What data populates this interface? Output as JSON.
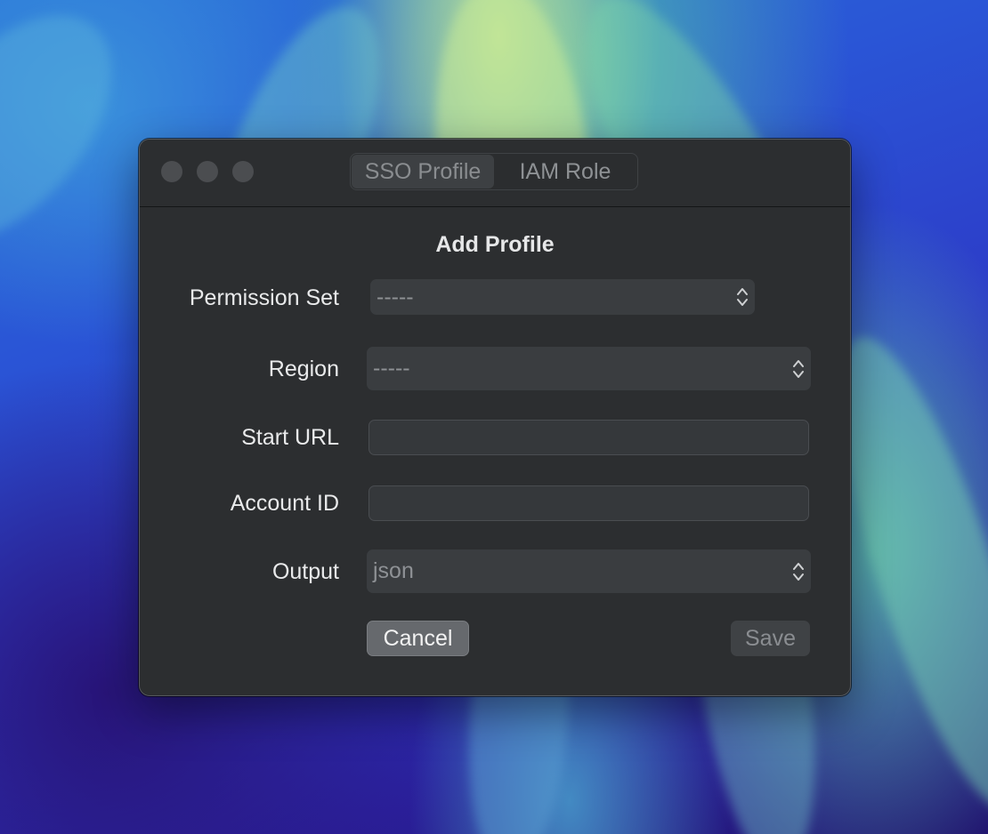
{
  "window": {
    "controls": [
      "close",
      "minimize",
      "zoom"
    ]
  },
  "tabs": [
    {
      "label": "SSO Profile",
      "selected": true
    },
    {
      "label": "IAM Role",
      "selected": false
    }
  ],
  "dialog": {
    "title": "Add Profile"
  },
  "form": {
    "permission_set": {
      "label": "Permission Set",
      "value": "-----"
    },
    "region": {
      "label": "Region",
      "value": "-----"
    },
    "start_url": {
      "label": "Start URL",
      "value": ""
    },
    "account_id": {
      "label": "Account ID",
      "value": ""
    },
    "output": {
      "label": "Output",
      "value": "json"
    }
  },
  "buttons": {
    "cancel": "Cancel",
    "save": "Save"
  },
  "colors": {
    "window_bg": "#2c2e30",
    "control_bg": "#3a3d40",
    "cancel_bg": "#66696d"
  }
}
